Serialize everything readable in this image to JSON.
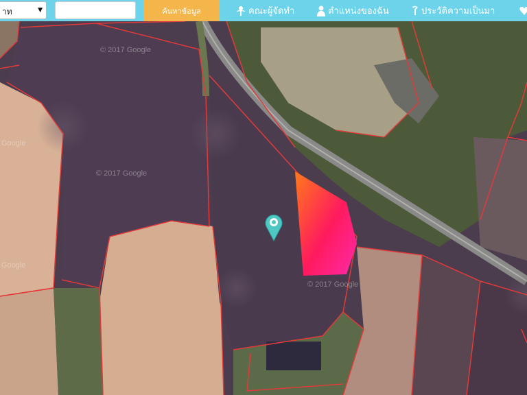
{
  "header": {
    "province_select": {
      "value": "าท"
    },
    "search": {
      "value": "",
      "placeholder": ""
    },
    "search_button_label": "ค้นหาข้อมูล",
    "nav": [
      {
        "label": "คณะผู้จัดทำ",
        "icon": "people-icon"
      },
      {
        "label": "ตำแหน่งของฉัน",
        "icon": "person-icon"
      },
      {
        "label": "ประวัติความเป็นมา",
        "icon": "info-icon"
      },
      {
        "label": "",
        "icon": "heart-icon"
      }
    ]
  },
  "map": {
    "type": "satellite",
    "watermarks": [
      "© 2017 Google",
      "© 2017 Google",
      "© 2017 Google",
      "Google",
      "Google"
    ],
    "parcel_border_color": "#e23a3a",
    "highlight_gradient": [
      "#ff7a1a",
      "#ff1a5e",
      "#ff2aa8"
    ],
    "marker": {
      "icon": "map-pin-icon",
      "color": "#4fc7c3"
    }
  }
}
